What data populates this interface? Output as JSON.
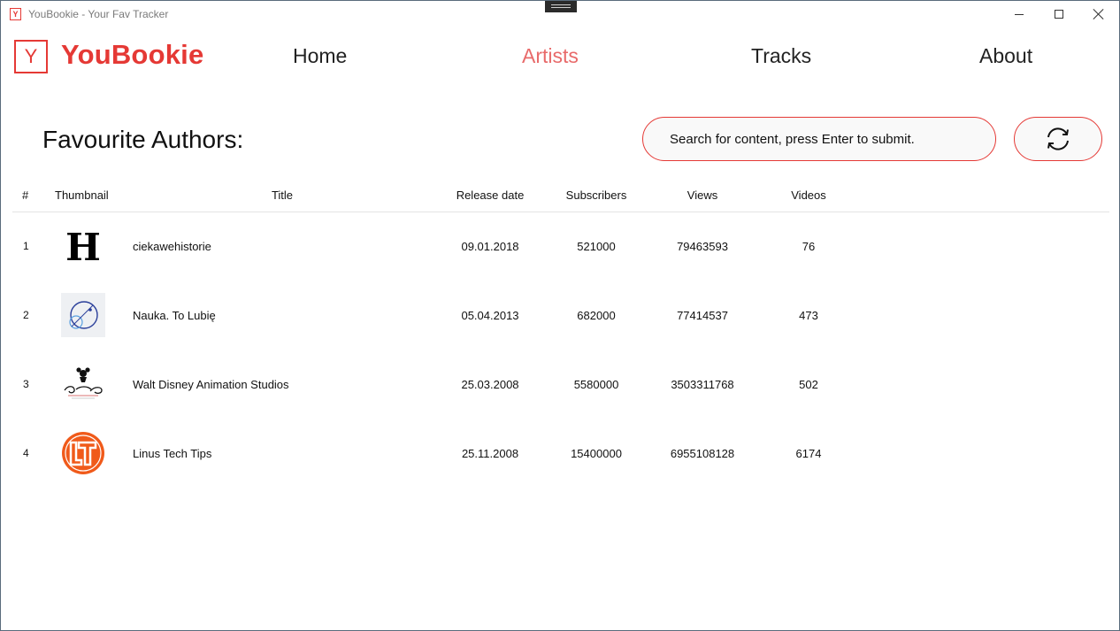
{
  "window": {
    "icon_letter": "Y",
    "title": "YouBookie - Your Fav Tracker"
  },
  "brand": {
    "logo_letter": "Y",
    "name": "YouBookie"
  },
  "nav": {
    "items": [
      {
        "label": "Home",
        "active": false
      },
      {
        "label": "Artists",
        "active": true
      },
      {
        "label": "Tracks",
        "active": false
      },
      {
        "label": "About",
        "active": false
      }
    ]
  },
  "page": {
    "title": "Favourite Authors:"
  },
  "search": {
    "placeholder": "Search for content, press Enter to submit."
  },
  "refresh": {
    "icon": "refresh-icon"
  },
  "table": {
    "columns": [
      "#",
      "Thumbnail",
      "Title",
      "Release date",
      "Subscribers",
      "Views",
      "Videos"
    ],
    "rows": [
      {
        "num": "1",
        "thumb": "history-h-logo",
        "title": "ciekawehistorie",
        "release": "09.01.2018",
        "subscribers": "521000",
        "views": "79463593",
        "videos": "76"
      },
      {
        "num": "2",
        "thumb": "science-orbit-logo",
        "title": "Nauka. To Lubię",
        "release": "05.04.2013",
        "subscribers": "682000",
        "views": "77414537",
        "videos": "473"
      },
      {
        "num": "3",
        "thumb": "disney-logo",
        "title": "Walt Disney Animation Studios",
        "release": "25.03.2008",
        "subscribers": "5580000",
        "views": "3503311768",
        "videos": "502"
      },
      {
        "num": "4",
        "thumb": "ltt-logo",
        "title": "Linus Tech Tips",
        "release": "25.11.2008",
        "subscribers": "15400000",
        "views": "6955108128",
        "videos": "6174"
      }
    ]
  },
  "colors": {
    "accent": "#e53935",
    "nav_active": "#e86a6a",
    "ltt_orange": "#f05a1a",
    "science_blue": "#2a3f9a"
  }
}
